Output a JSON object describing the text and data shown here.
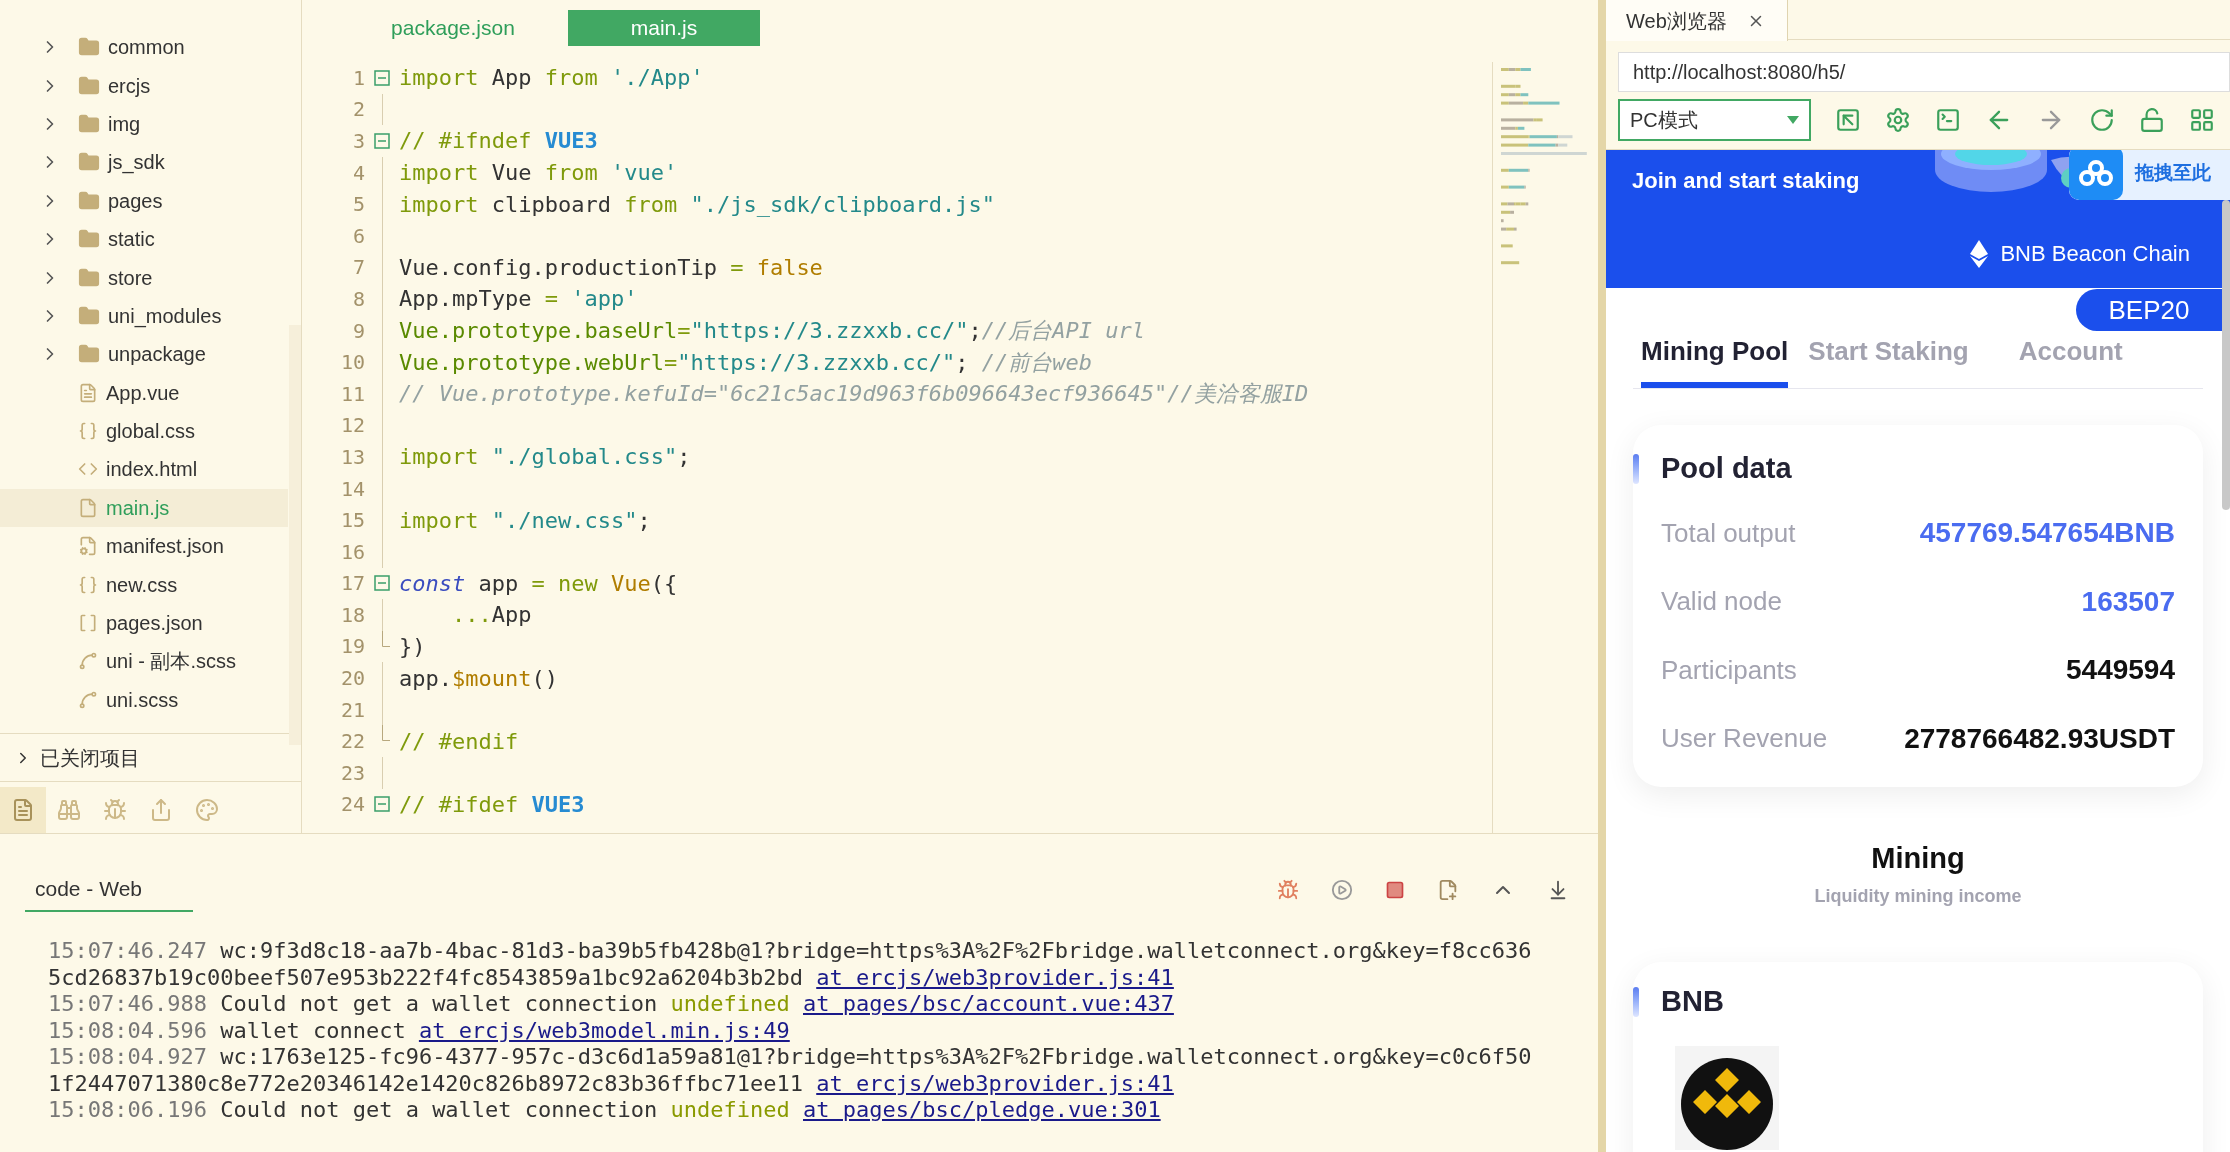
{
  "sidebar": {
    "items": [
      {
        "name": "common",
        "kind": "folder",
        "selected": false
      },
      {
        "name": "ercjs",
        "kind": "folder",
        "selected": false
      },
      {
        "name": "img",
        "kind": "folder",
        "selected": false
      },
      {
        "name": "js_sdk",
        "kind": "folder",
        "selected": false
      },
      {
        "name": "pages",
        "kind": "folder",
        "selected": false
      },
      {
        "name": "static",
        "kind": "folder",
        "selected": false
      },
      {
        "name": "store",
        "kind": "folder",
        "selected": false
      },
      {
        "name": "uni_modules",
        "kind": "folder",
        "selected": false
      },
      {
        "name": "unpackage",
        "kind": "folder",
        "selected": false
      },
      {
        "name": "App.vue",
        "kind": "vue",
        "selected": false
      },
      {
        "name": "global.css",
        "kind": "css",
        "selected": false
      },
      {
        "name": "index.html",
        "kind": "html",
        "selected": false
      },
      {
        "name": "main.js",
        "kind": "js",
        "selected": true
      },
      {
        "name": "manifest.json",
        "kind": "config",
        "selected": false
      },
      {
        "name": "new.css",
        "kind": "css",
        "selected": false
      },
      {
        "name": "pages.json",
        "kind": "json",
        "selected": false
      },
      {
        "name": "uni - 副本.scss",
        "kind": "scss",
        "selected": false
      },
      {
        "name": "uni.scss",
        "kind": "scss",
        "selected": false
      }
    ],
    "closed_projects": "已关闭项目",
    "bottom_tabs": [
      {
        "selected": true
      },
      {
        "selected": false
      },
      {
        "selected": false
      },
      {
        "selected": false
      },
      {
        "selected": false
      }
    ]
  },
  "editor": {
    "tabs": [
      {
        "label": "package.json",
        "selected": false
      },
      {
        "label": "main.js",
        "selected": true
      }
    ],
    "lines": [
      {
        "number": "1",
        "fold_start": true,
        "tokens": [
          {
            "kind": "keyword",
            "s": "import"
          },
          {
            "kind": "plain",
            "s": " App "
          },
          {
            "kind": "keyword",
            "s": "from"
          },
          {
            "kind": "string",
            "s": " './App'"
          }
        ]
      },
      {
        "number": "2"
      },
      {
        "number": "3",
        "fold_start": true,
        "tokens": [
          {
            "kind": "comment",
            "s": "// #ifndef "
          },
          {
            "kind": "directive",
            "s": "VUE3"
          }
        ]
      },
      {
        "number": "4",
        "tokens": [
          {
            "kind": "keyword",
            "s": "import"
          },
          {
            "kind": "plain",
            "s": " Vue "
          },
          {
            "kind": "keyword",
            "s": "from"
          },
          {
            "kind": "string",
            "s": " 'vue'"
          }
        ]
      },
      {
        "number": "5",
        "tokens": [
          {
            "kind": "keyword",
            "s": "import"
          },
          {
            "kind": "plain",
            "s": " clipboard "
          },
          {
            "kind": "keyword",
            "s": "from"
          },
          {
            "kind": "string",
            "s": " \"./js_sdk/clipboard.js\""
          }
        ]
      },
      {
        "number": "6"
      },
      {
        "number": "7",
        "tokens": [
          {
            "kind": "plain",
            "s": "Vue.config.productionTip "
          },
          {
            "kind": "operator",
            "s": "= "
          },
          {
            "kind": "constant",
            "s": "false"
          }
        ]
      },
      {
        "number": "8",
        "tokens": [
          {
            "kind": "plain",
            "s": "App.mpType "
          },
          {
            "kind": "operator",
            "s": "= "
          },
          {
            "kind": "string",
            "s": "'app'"
          }
        ]
      },
      {
        "number": "9",
        "tokens": [
          {
            "kind": "variable",
            "s": "Vue.prototype.baseUrl"
          },
          {
            "kind": "operator",
            "s": "="
          },
          {
            "kind": "string",
            "s": "\"https://3.zzxxb.cc/\""
          },
          {
            "kind": "plain",
            "s": ";"
          },
          {
            "kind": "note",
            "s": "//后台API url"
          }
        ]
      },
      {
        "number": "10",
        "tokens": [
          {
            "kind": "variable",
            "s": "Vue.prototype.webUrl"
          },
          {
            "kind": "operator",
            "s": "="
          },
          {
            "kind": "string",
            "s": "\"https://3.zzxxb.cc/\""
          },
          {
            "kind": "plain",
            "s": "; "
          },
          {
            "kind": "note",
            "s": "//前台web"
          }
        ]
      },
      {
        "number": "11",
        "tokens": [
          {
            "kind": "note",
            "s": "// Vue.prototype.kefuId=\"6c21c5ac19d963f6b096643ecf936645\"//美洽客服ID"
          }
        ]
      },
      {
        "number": "12"
      },
      {
        "number": "13",
        "tokens": [
          {
            "kind": "keyword",
            "s": "import"
          },
          {
            "kind": "string",
            "s": " \"./global.css\""
          },
          {
            "kind": "plain",
            "s": ";"
          }
        ]
      },
      {
        "number": "14"
      },
      {
        "number": "15",
        "tokens": [
          {
            "kind": "keyword",
            "s": "import"
          },
          {
            "kind": "string",
            "s": " \"./new.css\""
          },
          {
            "kind": "plain",
            "s": ";"
          }
        ]
      },
      {
        "number": "16"
      },
      {
        "number": "17",
        "fold_start": true,
        "tokens": [
          {
            "kind": "storage",
            "s": "const"
          },
          {
            "kind": "plain",
            "s": " app "
          },
          {
            "kind": "operator",
            "s": "="
          },
          {
            "kind": "keyword",
            "s": " new"
          },
          {
            "kind": "function",
            "s": " Vue"
          },
          {
            "kind": "plain",
            "s": "({"
          }
        ]
      },
      {
        "number": "18",
        "tokens": [
          {
            "kind": "operator",
            "s": "    ..."
          },
          {
            "kind": "plain",
            "s": "App"
          }
        ]
      },
      {
        "number": "19",
        "fold_end": true,
        "tokens": [
          {
            "kind": "plain",
            "s": "})"
          }
        ]
      },
      {
        "number": "20",
        "tokens": [
          {
            "kind": "plain",
            "s": "app."
          },
          {
            "kind": "function",
            "s": "$mount"
          },
          {
            "kind": "plain",
            "s": "()"
          }
        ]
      },
      {
        "number": "21"
      },
      {
        "number": "22",
        "fold_end": true,
        "tokens": [
          {
            "kind": "comment",
            "s": "// #endif"
          }
        ]
      },
      {
        "number": "23"
      },
      {
        "number": "24",
        "fold_start": true,
        "tokens": [
          {
            "kind": "comment",
            "s": "// #ifdef "
          },
          {
            "kind": "directive",
            "s": "VUE3"
          }
        ]
      }
    ]
  },
  "console": {
    "tab": "code - Web",
    "entries": [
      {
        "time": "15:07:46.247",
        "parts": [
          {
            "kind": "plain",
            "s": "wc:9f3d8c18-aa7b-4bac-81d3-ba39b5fb428b@1?bridge=https%3A%2F%2Fbridge.walletconnect.org&key=f8cc6365cd26837b19c00beef507e953b222f4fc8543859a1bc92a6204b3b2bd"
          }
        ],
        "link": "at ercjs/web3provider.js:41"
      },
      {
        "time": "15:07:46.988",
        "parts": [
          {
            "kind": "plain",
            "s": "Could not get a wallet connection "
          },
          {
            "kind": "undefined",
            "s": "undefined"
          }
        ],
        "link": "at pages/bsc/account.vue:437"
      },
      {
        "time": "15:08:04.596",
        "parts": [
          {
            "kind": "plain",
            "s": "wallet connect"
          }
        ],
        "link": "at ercjs/web3model.min.js:49"
      },
      {
        "time": "15:08:04.927",
        "parts": [
          {
            "kind": "plain",
            "s": "wc:1763e125-fc96-4377-957c-d3c6d1a59a81@1?bridge=https%3A%2F%2Fbridge.walletconnect.org&key=c0c6f501f2447071380c8e772e20346142e1420c826b8972c83b36ffbc71ee11"
          }
        ],
        "link": "at ercjs/web3provider.js:41"
      },
      {
        "time": "15:08:06.196",
        "parts": [
          {
            "kind": "plain",
            "s": "Could not get a wallet connection "
          },
          {
            "kind": "undefined",
            "s": "undefined"
          }
        ],
        "link": "at pages/bsc/pledge.vue:301"
      }
    ]
  },
  "browser": {
    "tab": "Web浏览器",
    "url": "http://localhost:8080/h5/",
    "mode": "PC模式",
    "back_disabled": false,
    "forward_disabled": true,
    "page": {
      "banner_title": "Join and start staking",
      "overlay_label": "拖拽至此",
      "chain": "BNB Beacon Chain",
      "network": "BEP20",
      "tabs": [
        {
          "label": "Mining Pool",
          "selected": true
        },
        {
          "label": "Start Staking",
          "selected": false
        },
        {
          "label": "Account",
          "selected": false
        }
      ],
      "pool": {
        "title": "Pool data",
        "rows": [
          {
            "label": "Total output",
            "value": "457769.547654BNB",
            "highlight": true
          },
          {
            "label": "Valid node",
            "value": "163507",
            "highlight": true
          },
          {
            "label": "Participants",
            "value": "5449594",
            "highlight": false
          },
          {
            "label": "User Revenue",
            "value": "2778766482.93USDT",
            "highlight": false
          }
        ]
      },
      "section": {
        "title": "Mining",
        "subtitle": "Liquidity mining income"
      },
      "coin_card": {
        "title": "BNB"
      }
    }
  }
}
